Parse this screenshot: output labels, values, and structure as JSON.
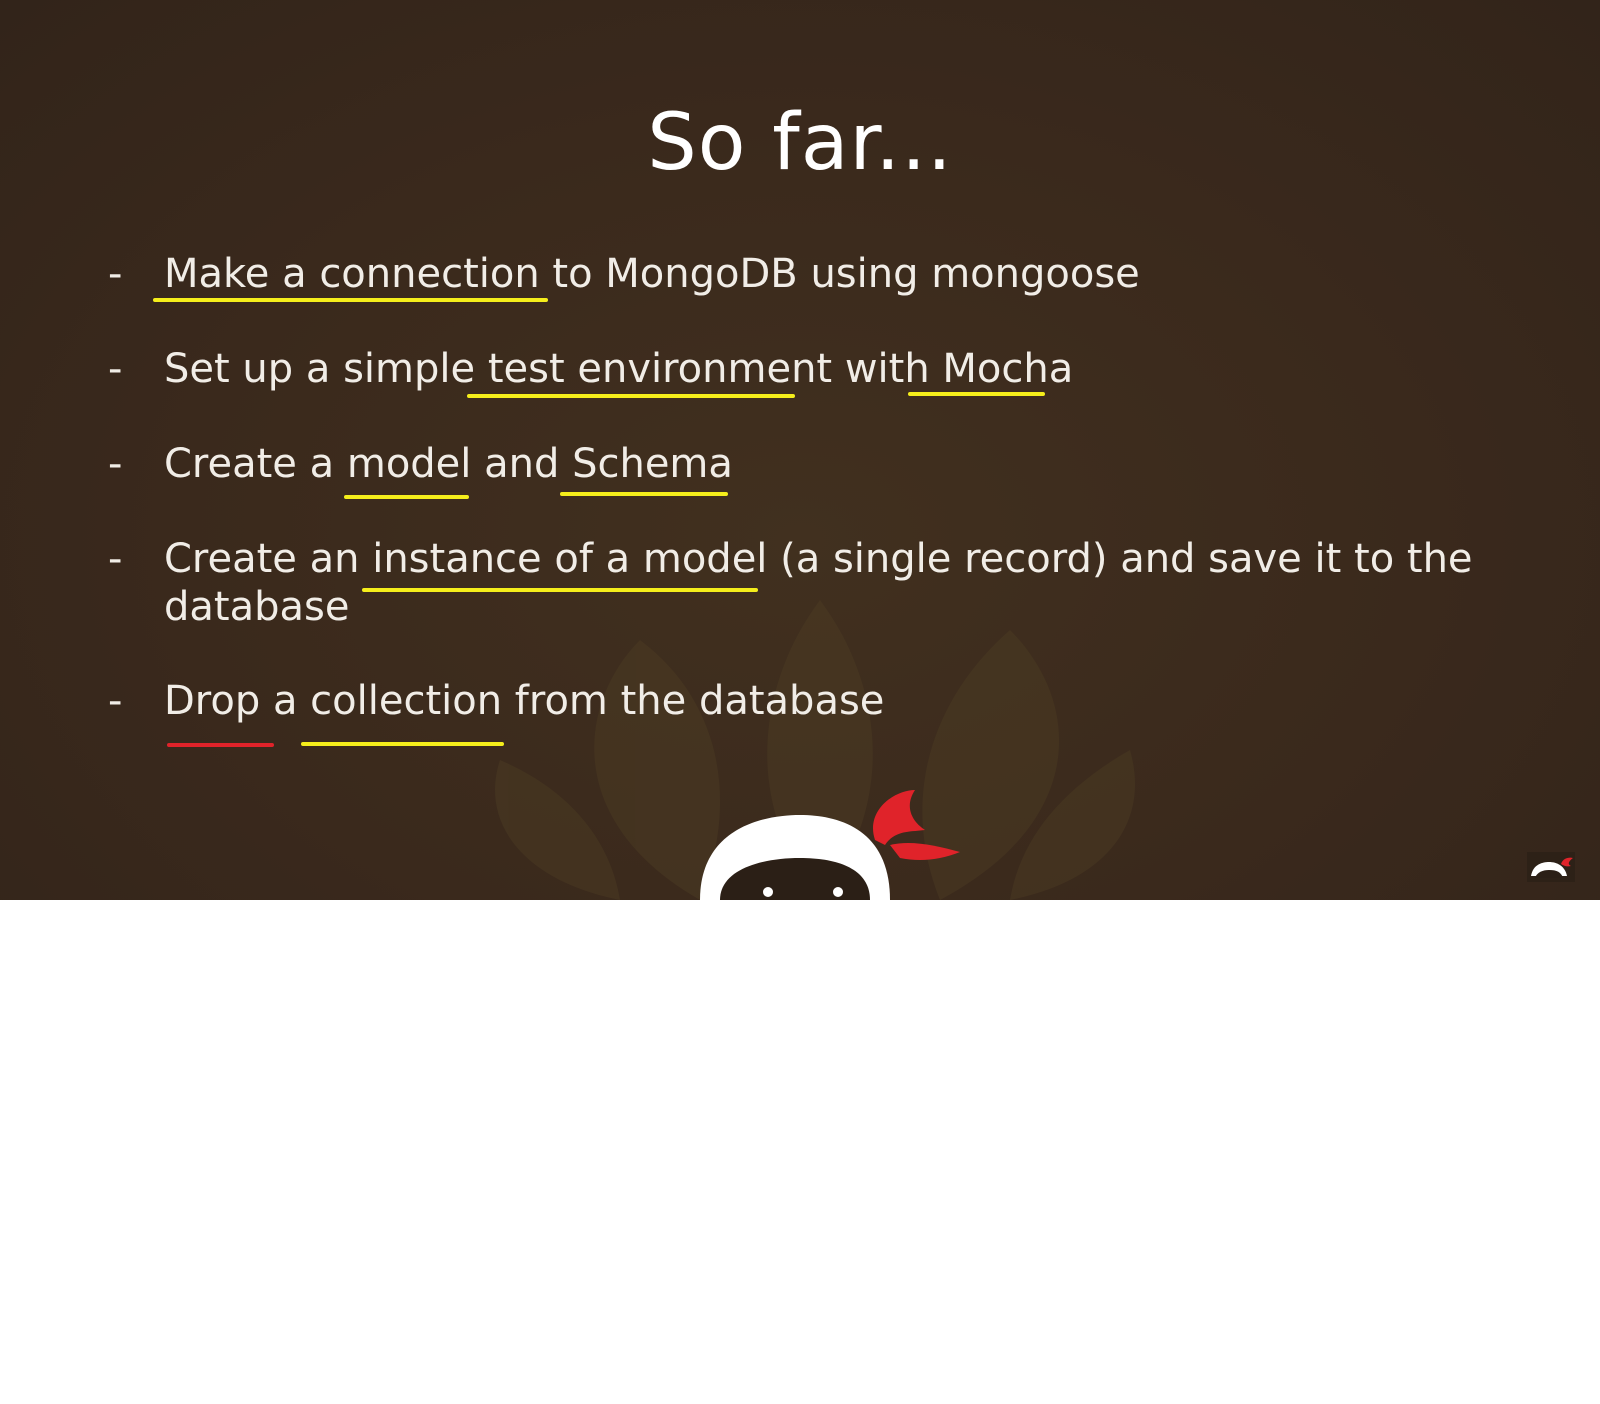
{
  "slide": {
    "title": "So far...",
    "dash": "-",
    "bullets": [
      {
        "text": "Make a connection to MongoDB using mongoose"
      },
      {
        "text": "Set up a simple test environment with Mocha"
      },
      {
        "text": "Create a model and Schema"
      },
      {
        "text": "Create an instance of a model (a single record) and save it to the database"
      },
      {
        "text": "Drop a collection from the database"
      }
    ],
    "colors": {
      "background": "#3a291c",
      "text": "#f1ede7",
      "highlight_yellow": "#f5ee1b",
      "highlight_red": "#e0232a"
    }
  },
  "icons": {
    "mascot": "ninja-mascot-icon",
    "corner": "ninja-logo-icon"
  }
}
